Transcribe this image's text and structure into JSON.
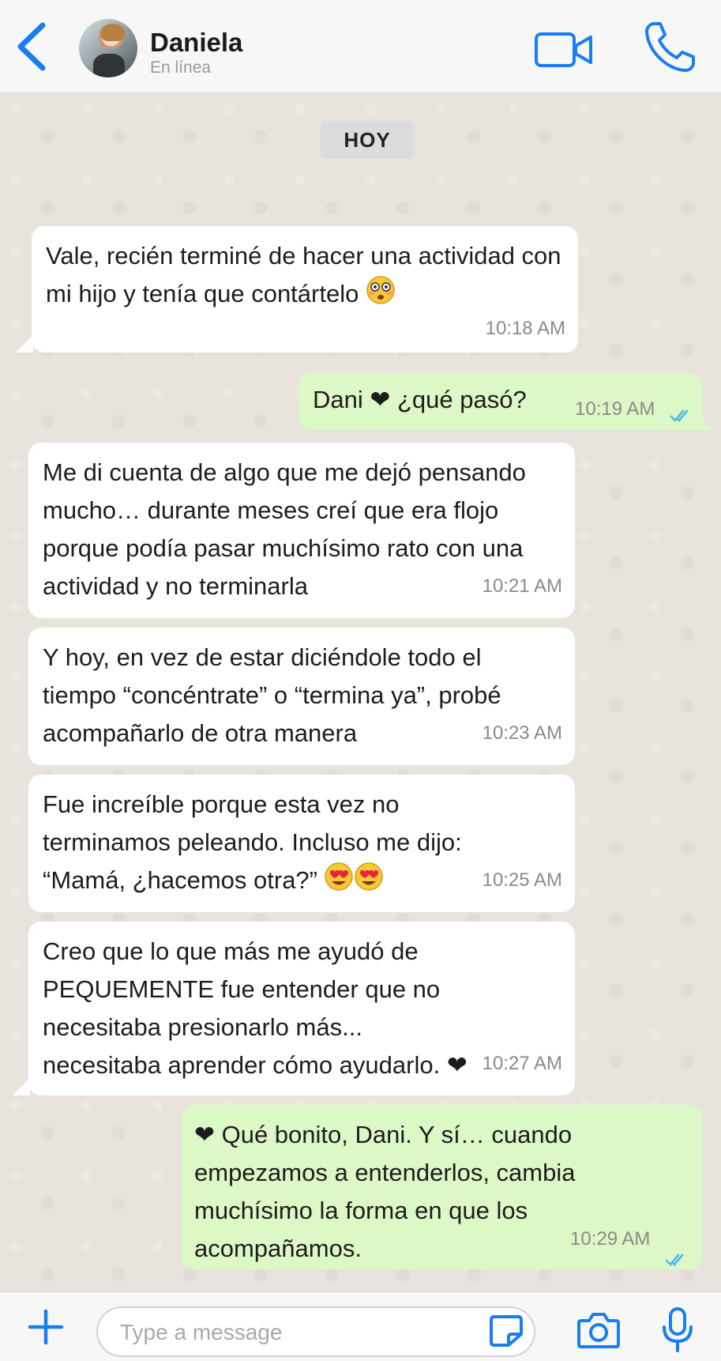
{
  "header": {
    "contact_name": "Daniela",
    "status": "En línea"
  },
  "date_label": "HOY",
  "messages": [
    {
      "text": "Vale, recién terminé de hacer una actividad con mi hijo y tenía que contártelo",
      "emoji": "flushed-face",
      "time": "10:18 AM",
      "direction": "incoming"
    },
    {
      "text": "Dani ❤  ¿qué pasó?",
      "time": "10:19 AM",
      "direction": "outgoing",
      "status": "read"
    },
    {
      "text": "Me di cuenta de algo que me dejó pensando mucho… durante meses creí que era flojo porque podía pasar muchísimo rato con una actividad y no terminarla",
      "time": "10:21 AM",
      "direction": "incoming"
    },
    {
      "text": "Y hoy, en vez de estar diciéndole todo el tiempo “concéntrate” o “termina ya”, probé acompañarlo de otra manera",
      "time": "10:23 AM",
      "direction": "incoming"
    },
    {
      "text": "Fue increíble porque esta vez no terminamos peleando. Incluso me dijo: “Mamá, ¿hacemos otra?”",
      "emoji": "heart-eyes-face x2",
      "time": "10:25 AM",
      "direction": "incoming"
    },
    {
      "text": "Creo que lo que más me ayudó de PEQUEMENTE fue entender que no necesitaba presionarlo más... necesitaba aprender cómo ayudarlo. ❤",
      "time": "10:27 AM",
      "direction": "incoming"
    },
    {
      "text": "❤  Qué bonito, Dani. Y sí… cuando empezamos a entenderlos, cambia muchísimo la forma en que los acompañamos.",
      "time": "10:29 AM",
      "direction": "outgoing",
      "status": "read"
    }
  ],
  "composer": {
    "placeholder": "Type a message"
  },
  "colors": {
    "accent": "#1a7ef0",
    "incoming_bubble": "#ffffff",
    "outgoing_bubble": "#dcf8c6",
    "read_ticks": "#4fb6ec",
    "chat_background": "#e8e3dc"
  },
  "icons": [
    "back-chevron-icon",
    "video-call-icon",
    "phone-icon",
    "plus-icon",
    "sticker-icon",
    "camera-icon",
    "microphone-icon",
    "double-check-icon"
  ]
}
